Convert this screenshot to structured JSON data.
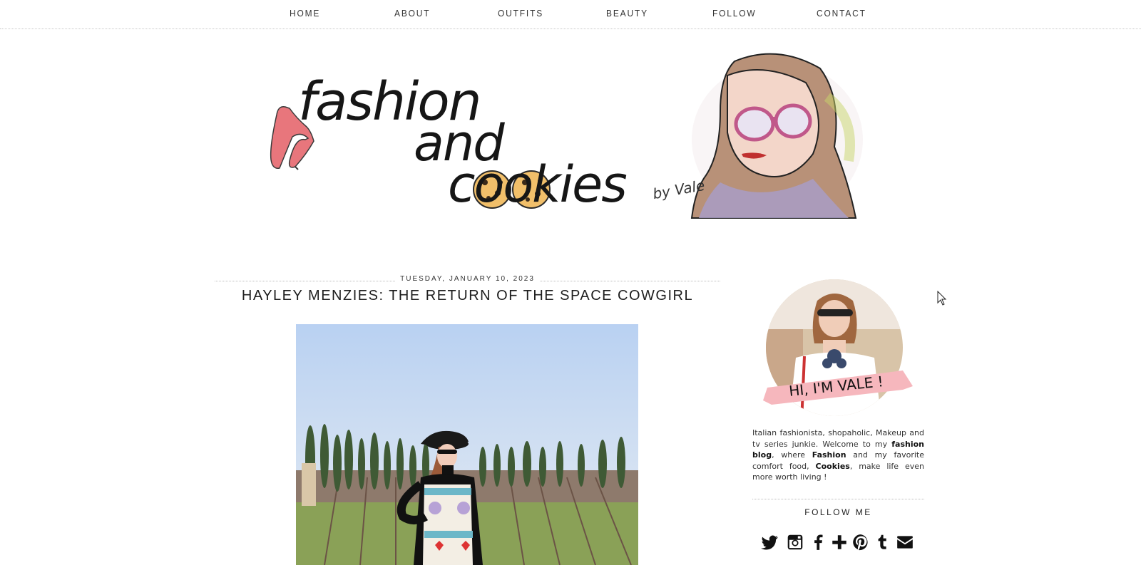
{
  "nav": {
    "items": [
      {
        "label": "HOME"
      },
      {
        "label": "ABOUT"
      },
      {
        "label": "OUTFITS"
      },
      {
        "label": "BEAUTY"
      },
      {
        "label": "FOLLOW"
      },
      {
        "label": "CONTACT"
      }
    ]
  },
  "header": {
    "logo_line1": "fashion",
    "logo_line2": "and",
    "logo_line3": "cookies",
    "logo_byline": "by Vale"
  },
  "post": {
    "date": "TUESDAY, JANUARY 10, 2023",
    "title": "HAYLEY MENZIES: THE RETURN OF THE SPACE COWGIRL"
  },
  "sidebar": {
    "profile_banner": "HI, I'M VALE !",
    "about": {
      "part1": "Italian fashionista, shopaholic, Makeup and tv series junkie. Welcome to my ",
      "bold1": "fashion blog",
      "part2": ", where ",
      "bold2": "Fashion",
      "part3": " and my favorite comfort food, ",
      "bold3": "Cookies",
      "part4": ", make life even more worth living !"
    },
    "follow_title": "FOLLOW ME",
    "social_icons": [
      "twitter-icon",
      "instagram-icon",
      "facebook-icon",
      "google-plus-icon",
      "pinterest-icon",
      "tumblr-icon",
      "email-icon"
    ]
  },
  "colors": {
    "accent_pink": "#f6b7bd",
    "shoe_pink": "#e8767c",
    "text_dark": "#222222",
    "dotted_rule": "#bdbdbd"
  }
}
